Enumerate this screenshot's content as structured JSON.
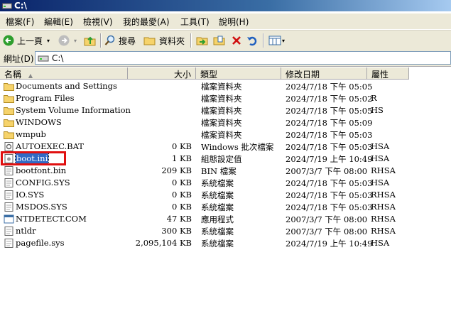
{
  "window": {
    "title": "C:\\"
  },
  "menu": [
    "檔案(F)",
    "編輯(E)",
    "檢視(V)",
    "我的最愛(A)",
    "工具(T)",
    "說明(H)"
  ],
  "toolbar": {
    "back_label": "上一頁",
    "search_label": "搜尋",
    "folders_label": "資料夾"
  },
  "address": {
    "label": "網址(D)",
    "value": "C:\\"
  },
  "columns": {
    "name": "名稱",
    "size": "大小",
    "type": "類型",
    "modified": "修改日期",
    "attr": "屬性"
  },
  "files": [
    {
      "icon": "folder-icon",
      "name": "Documents and Settings",
      "size": "",
      "type": "檔案資料夾",
      "modified": "2024/7/18 下午 05:05",
      "attr": ""
    },
    {
      "icon": "folder-icon",
      "name": "Program Files",
      "size": "",
      "type": "檔案資料夾",
      "modified": "2024/7/18 下午 05:02",
      "attr": "R"
    },
    {
      "icon": "folder-icon",
      "name": "System Volume Information",
      "size": "",
      "type": "檔案資料夾",
      "modified": "2024/7/18 下午 05:05",
      "attr": "HS"
    },
    {
      "icon": "folder-icon",
      "name": "WINDOWS",
      "size": "",
      "type": "檔案資料夾",
      "modified": "2024/7/18 下午 05:09",
      "attr": ""
    },
    {
      "icon": "folder-icon",
      "name": "wmpub",
      "size": "",
      "type": "檔案資料夾",
      "modified": "2024/7/18 下午 05:03",
      "attr": ""
    },
    {
      "icon": "batch-file-icon",
      "name": "AUTOEXEC.BAT",
      "size": "0 KB",
      "type": "Windows 批次檔案",
      "modified": "2024/7/18 下午 05:03",
      "attr": "HSA"
    },
    {
      "icon": "settings-file-icon",
      "name": "boot.ini",
      "size": "1 KB",
      "type": "組態設定值",
      "modified": "2024/7/19 上午 10:49",
      "attr": "HSA"
    },
    {
      "icon": "file-icon",
      "name": "bootfont.bin",
      "size": "209 KB",
      "type": "BIN 檔案",
      "modified": "2007/3/7 下午 08:00",
      "attr": "RHSA"
    },
    {
      "icon": "system-file-icon",
      "name": "CONFIG.SYS",
      "size": "0 KB",
      "type": "系統檔案",
      "modified": "2024/7/18 下午 05:03",
      "attr": "HSA"
    },
    {
      "icon": "system-file-icon",
      "name": "IO.SYS",
      "size": "0 KB",
      "type": "系統檔案",
      "modified": "2024/7/18 下午 05:03",
      "attr": "RHSA"
    },
    {
      "icon": "system-file-icon",
      "name": "MSDOS.SYS",
      "size": "0 KB",
      "type": "系統檔案",
      "modified": "2024/7/18 下午 05:03",
      "attr": "RHSA"
    },
    {
      "icon": "application-icon",
      "name": "NTDETECT.COM",
      "size": "47 KB",
      "type": "應用程式",
      "modified": "2007/3/7 下午 08:00",
      "attr": "RHSA"
    },
    {
      "icon": "system-file-icon",
      "name": "ntldr",
      "size": "300 KB",
      "type": "系統檔案",
      "modified": "2007/3/7 下午 08:00",
      "attr": "RHSA"
    },
    {
      "icon": "system-file-icon",
      "name": "pagefile.sys",
      "size": "2,095,104 KB",
      "type": "系統檔案",
      "modified": "2024/7/19 上午 10:49",
      "attr": "HSA"
    }
  ],
  "selected_file": "boot.ini",
  "colors": {
    "title_bar": "#0a246a",
    "chrome": "#ece9d8",
    "selection": "#316ac5",
    "highlight_box": "#e01010"
  }
}
